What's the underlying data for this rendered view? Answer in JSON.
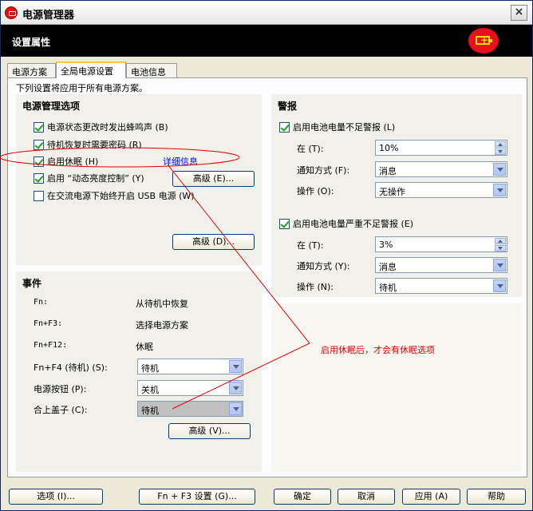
{
  "window": {
    "title": "电源管理器",
    "close_label": "×"
  },
  "header": {
    "title": "设置属性"
  },
  "tabs": [
    "电源方案",
    "全局电源设置",
    "电池信息"
  ],
  "intro": "下列设置将应用于所有电源方案。",
  "power_options": {
    "title": "电源管理选项",
    "items": [
      {
        "label": "电源状态更改时发出蜂鸣声 (B)",
        "checked": true
      },
      {
        "label": "待机恢复时需要密码 (R)",
        "checked": true
      },
      {
        "label": "启用休眠 (H)",
        "checked": true
      },
      {
        "label": "启用 “动态亮度控制” (Y)",
        "checked": true
      },
      {
        "label": "在交流电源下始终开启 USB 电源 (W)",
        "checked": false
      }
    ],
    "details_link": "详细信息",
    "advanced_e": "高级 (E)...",
    "advanced_d": "高级 (D)..."
  },
  "alarms": {
    "title": "警报",
    "low": {
      "label": "启用电池电量不足警报 (L)",
      "at_label": "在 (T):",
      "at_value": "10%",
      "notify_label": "通知方式 (F):",
      "notify_value": "消息",
      "action_label": "操作 (O):",
      "action_value": "无操作"
    },
    "critical": {
      "label": "启用电池电量严重不足警报 (E)",
      "at_label": "在 (T):",
      "at_value": "3%",
      "notify_label": "通知方式 (Y):",
      "notify_value": "消息",
      "action_label": "操作 (N):",
      "action_value": "待机"
    }
  },
  "events": {
    "title": "事件",
    "fn_label": "Fn:",
    "fn_value": "从待机中恢复",
    "fnf3_label": "Fn+F3:",
    "fnf3_value": "选择电源方案",
    "fnf12_label": "Fn+F12:",
    "fnf12_value": "休眠",
    "fnf4_label": "Fn+F4 (待机) (S):",
    "fnf4_value": "待机",
    "power_btn_label": "电源按钮 (P):",
    "power_btn_value": "关机",
    "lid_label": "合上盖子 (C):",
    "lid_value": "待机",
    "advanced_v": "高级 (V)..."
  },
  "annotation": {
    "text": "启用休眠后，才会有休眠选项",
    "color": "#e00000"
  },
  "footer": {
    "options": "选项 (I)...",
    "fnf3_settings": "Fn + F3 设置 (G)...",
    "ok": "确定",
    "cancel": "取消",
    "apply": "应用 (A)",
    "help": "帮助"
  },
  "colors": {
    "header_bg": "#000000",
    "accent_tab": "#ffc83c",
    "badge": "#e8101a"
  },
  "icons": {
    "app": "power-manager-icon",
    "badge": "battery-charging-icon"
  }
}
